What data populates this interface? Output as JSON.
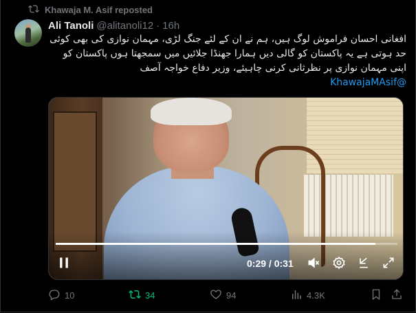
{
  "repost": {
    "text": "Khawaja M. Asif reposted"
  },
  "tweet": {
    "author_name": "Ali Tanoli",
    "handle": "@alitanoli12",
    "separator": "·",
    "time": "16h",
    "lines": [
      "افغانی احسان فراموش لوگ ہیں، ہم نے ان کے لئے جنگ لڑی، مہمان نوازی کی بھی کوئی",
      "حد ہوتی ہے یہ پاکستان کو گالی دیں ہمارا جھنڈا جلائیں میں سمجھتا ہوں پاکستان کو",
      "اپنی مہمان نوازی پر نظرثانی کرنی چاہیئے، وزیر دفاع خواجہ آصف"
    ],
    "mention": "@KhawajaMAsif"
  },
  "video": {
    "timecode": "0:29 / 0:31",
    "progress": 0.935
  },
  "actions": {
    "replies": "10",
    "reposts": "34",
    "likes": "94",
    "views": "4.3K"
  },
  "colors": {
    "background": "#000000",
    "accent": "#1d9bf0",
    "reposted": "#00ba7c",
    "muted": "#71767b"
  },
  "icons": {
    "repost": "repost-icon",
    "reply": "reply-icon",
    "like": "heart-icon",
    "views": "views-chart-icon",
    "bookmark": "bookmark-icon",
    "share": "share-icon",
    "play": "pause-icon",
    "mute": "mute-icon",
    "settings": "gear-icon",
    "popout": "popout-icon",
    "fullscreen": "fullscreen-icon"
  }
}
